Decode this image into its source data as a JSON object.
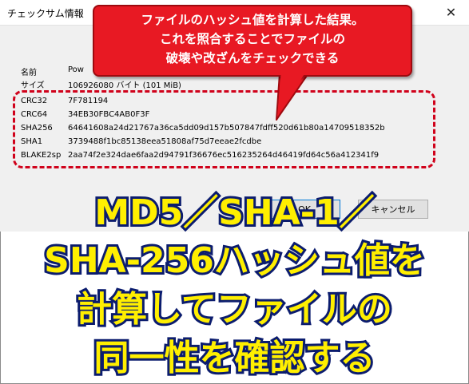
{
  "window": {
    "title": "チェックサム情報",
    "close_glyph": "✕"
  },
  "file_rows": [
    {
      "label": "名前",
      "value": "Pow"
    },
    {
      "label": "サイズ",
      "value": "106926080 バイト (101 MiB)"
    }
  ],
  "hash_rows": [
    {
      "label": "CRC32",
      "value": "7F781194"
    },
    {
      "label": "CRC64",
      "value": "34EB30FBC4AB0F3F"
    },
    {
      "label": "SHA256",
      "value": "64641608a24d21767a36ca5dd09d157b507847fdff520d61b80a14709518352b"
    },
    {
      "label": "SHA1",
      "value": "3739488f1bc85138eea51808af75d7eeae2fcdbe"
    },
    {
      "label": "BLAKE2sp",
      "value": "2aa74f2e324dae6faa2d94791f36676ec516235264d46419fd64c56a412341f9"
    }
  ],
  "buttons": {
    "ok": "OK",
    "cancel": "キャンセル"
  },
  "callout": {
    "lines": [
      "ファイルのハッシュ値を計算した結果。",
      "これを照合することでファイルの",
      "破壊や改ざんをチェックできる"
    ]
  },
  "caption": {
    "lines": [
      "MD5／SHA-1／",
      "SHA-256ハッシュ値を",
      "計算してファイルの",
      "同一性を確認する"
    ]
  },
  "colors": {
    "callout_red": "#e81923",
    "dashed_red": "#d0021b",
    "caption_yellow": "#ffef00",
    "caption_outline": "#0b1c6e"
  }
}
